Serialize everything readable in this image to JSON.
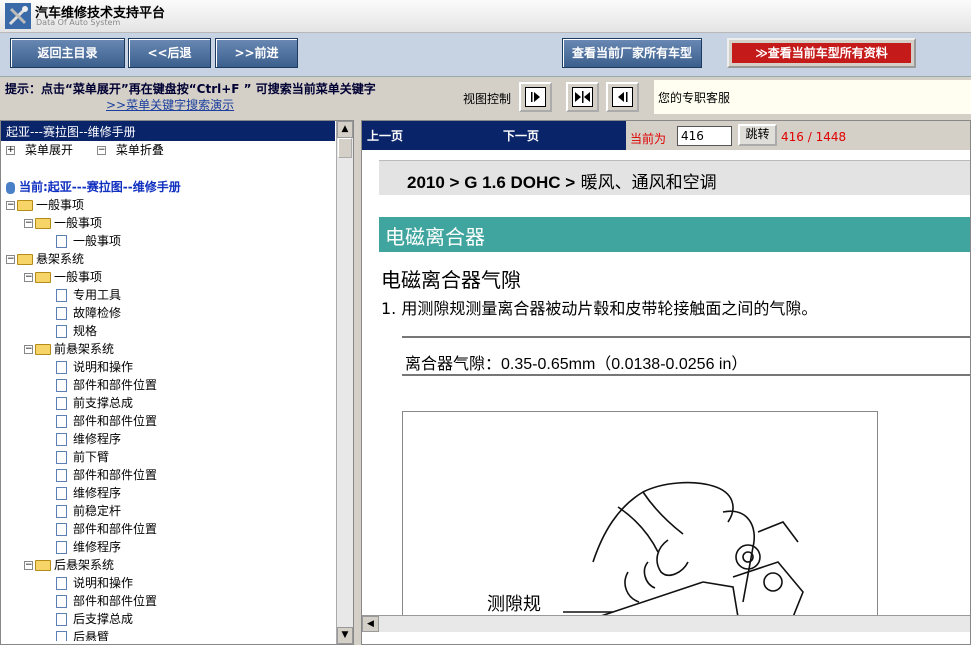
{
  "app": {
    "title": "汽车维修技术支持平台",
    "subtitle": "Data Of Auto System"
  },
  "toolbar": {
    "home_label": "返回主目录",
    "back_label": "<<后退",
    "forward_label": ">>前进",
    "makers_label": "查看当前厂家所有车型",
    "all_docs_label": "≫查看当前车型所有资料"
  },
  "hint": {
    "text": "提示：点击“菜单展开”再在键盘按“Ctrl+F ” 可搜索当前菜单关键字",
    "link": ">>菜单关键字搜索演示"
  },
  "view_control": {
    "label": "视图控制"
  },
  "support": {
    "text": "您的专职客服"
  },
  "left": {
    "header": "起亚---赛拉图--维修手册",
    "expand_label": "菜单展开",
    "collapse_label": "菜单折叠",
    "current_label": "当前:起亚---赛拉图--维修手册"
  },
  "tree": [
    {
      "label": "一般事项",
      "type": "folder"
    },
    {
      "label": "一般事项",
      "type": "folder"
    },
    {
      "label": "一般事项",
      "type": "doc"
    },
    {
      "label": "悬架系统",
      "type": "folder"
    },
    {
      "label": "一般事项",
      "type": "folder"
    },
    {
      "label": "专用工具",
      "type": "doc"
    },
    {
      "label": "故障检修",
      "type": "doc"
    },
    {
      "label": "规格",
      "type": "doc"
    },
    {
      "label": "前悬架系统",
      "type": "folder"
    },
    {
      "label": "说明和操作",
      "type": "doc"
    },
    {
      "label": "部件和部件位置",
      "type": "doc"
    },
    {
      "label": "前支撑总成",
      "type": "doc"
    },
    {
      "label": "部件和部件位置",
      "type": "doc"
    },
    {
      "label": "维修程序",
      "type": "doc"
    },
    {
      "label": "前下臂",
      "type": "doc"
    },
    {
      "label": "部件和部件位置",
      "type": "doc"
    },
    {
      "label": "维修程序",
      "type": "doc"
    },
    {
      "label": "前稳定杆",
      "type": "doc"
    },
    {
      "label": "部件和部件位置",
      "type": "doc"
    },
    {
      "label": "维修程序",
      "type": "doc"
    },
    {
      "label": "后悬架系统",
      "type": "folder"
    },
    {
      "label": "说明和操作",
      "type": "doc"
    },
    {
      "label": "部件和部件位置",
      "type": "doc"
    },
    {
      "label": "后支撑总成",
      "type": "doc"
    },
    {
      "label": "后悬臂",
      "type": "doc"
    }
  ],
  "pager": {
    "prev_label": "上一页",
    "next_label": "下一页",
    "current_label": "当前为",
    "page_value": "416",
    "goto_label": "跳转",
    "count": "416 / 1448"
  },
  "document": {
    "breadcrumb_bold": "2010 > G 1.6 DOHC >",
    "breadcrumb_rest": " 暖风、通风和空调",
    "section_header": "电磁离合器",
    "title": "电磁离合器气隙",
    "step": "1. 用测隙规测量离合器被动片毂和皮带轮接触面之间的气隙。",
    "spec": "离合器气隙：0.35-0.65mm（0.0138-0.0256 in）",
    "figure_label": "测隙规"
  },
  "colors": {
    "nav_blue": "#0a246a",
    "section_teal": "#3fa59e",
    "pager_red": "#e00000",
    "accent_red": "#c51a1a"
  }
}
